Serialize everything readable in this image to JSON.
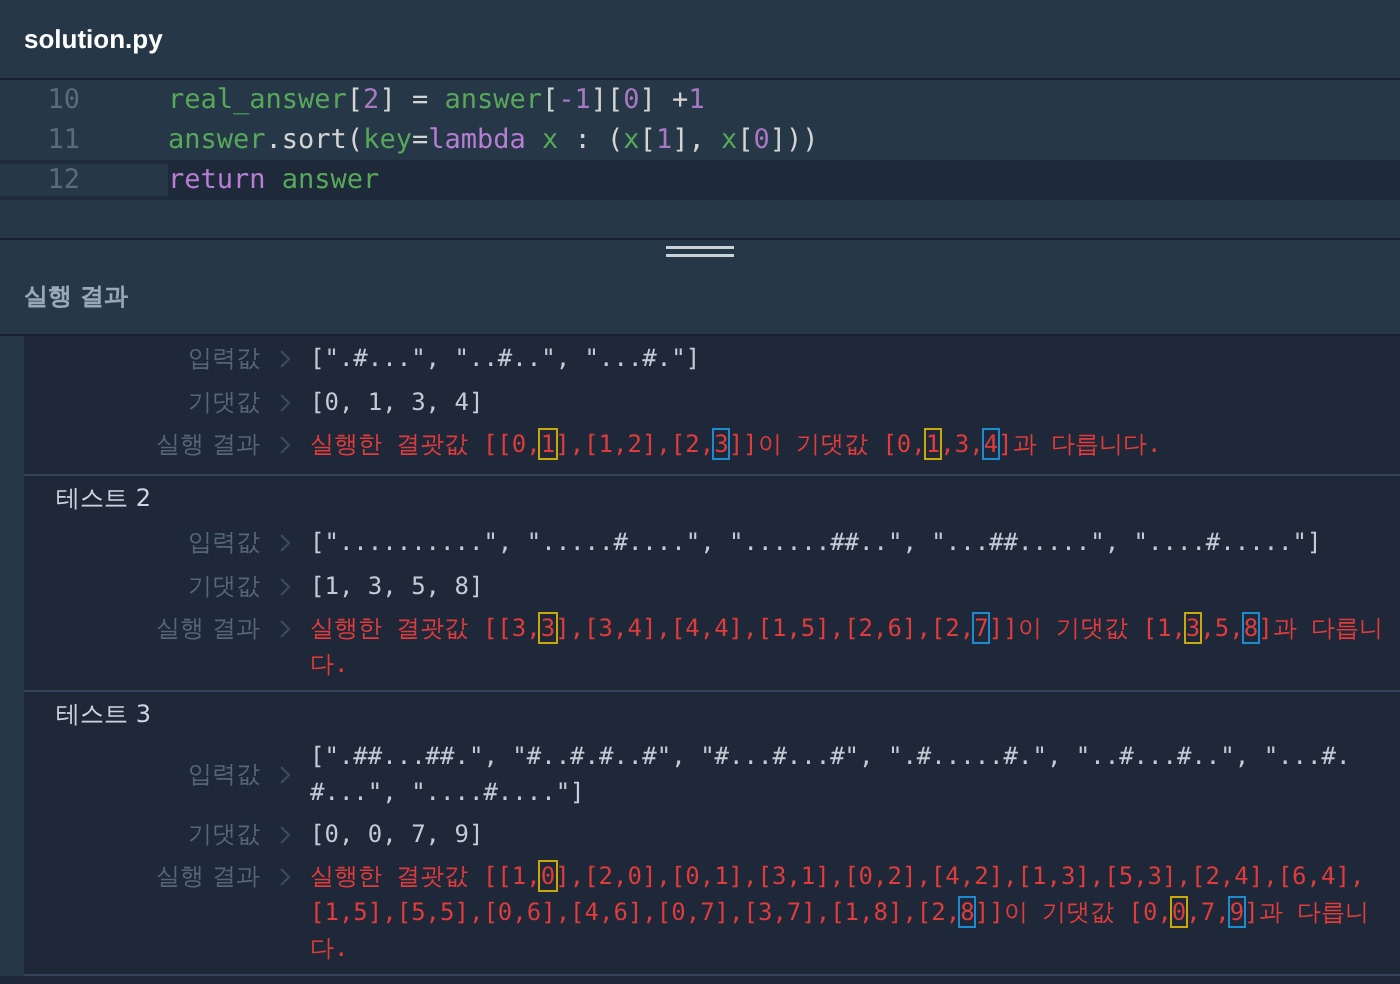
{
  "file": {
    "title": "solution.py"
  },
  "editor": {
    "lines": [
      {
        "number": "10",
        "selected": false,
        "tokens": [
          {
            "text": "real_answer",
            "kind": "name"
          },
          {
            "text": "[",
            "kind": "plain"
          },
          {
            "text": "2",
            "kind": "number"
          },
          {
            "text": "] = ",
            "kind": "plain"
          },
          {
            "text": "answer",
            "kind": "name"
          },
          {
            "text": "[",
            "kind": "plain"
          },
          {
            "text": "-1",
            "kind": "number"
          },
          {
            "text": "][",
            "kind": "plain"
          },
          {
            "text": "0",
            "kind": "number"
          },
          {
            "text": "] +",
            "kind": "plain"
          },
          {
            "text": "1",
            "kind": "number"
          }
        ]
      },
      {
        "number": "11",
        "selected": false,
        "tokens": [
          {
            "text": "answer",
            "kind": "name"
          },
          {
            "text": ".sort(",
            "kind": "plain"
          },
          {
            "text": "key",
            "kind": "name"
          },
          {
            "text": "=",
            "kind": "plain"
          },
          {
            "text": "lambda",
            "kind": "keyword"
          },
          {
            "text": " x",
            "kind": "name"
          },
          {
            "text": " : (",
            "kind": "plain"
          },
          {
            "text": "x",
            "kind": "name"
          },
          {
            "text": "[",
            "kind": "plain"
          },
          {
            "text": "1",
            "kind": "number"
          },
          {
            "text": "], ",
            "kind": "plain"
          },
          {
            "text": "x",
            "kind": "name"
          },
          {
            "text": "[",
            "kind": "plain"
          },
          {
            "text": "0",
            "kind": "number"
          },
          {
            "text": "]))",
            "kind": "plain"
          }
        ]
      },
      {
        "number": "12",
        "selected": true,
        "tokens": [
          {
            "text": "return",
            "kind": "keyword"
          },
          {
            "text": " answer",
            "kind": "name"
          }
        ]
      }
    ]
  },
  "results_panel": {
    "title": "실행 결과"
  },
  "tests": [
    {
      "rows": [
        {
          "label": "입력값",
          "kind": "value",
          "segments": [
            {
              "text": "[\".#...\", \"..#..\", \"...#.\"]"
            }
          ]
        },
        {
          "label": "기댓값",
          "kind": "value",
          "segments": [
            {
              "text": "[0, 1, 3, 4]"
            }
          ]
        },
        {
          "label": "실행 결과",
          "kind": "error",
          "segments": [
            {
              "text": "실행한 결괏값 [[0,"
            },
            {
              "text": "1",
              "color": "#c9a80a"
            },
            {
              "text": "],[1,2],[2,"
            },
            {
              "text": "3",
              "color": "#1e8ad0"
            },
            {
              "text": "]]이 기댓값 [0,"
            },
            {
              "text": "1",
              "color": "#c9a80a"
            },
            {
              "text": ",3,"
            },
            {
              "text": "4",
              "color": "#1e8ad0"
            },
            {
              "text": "]과 다릅니다."
            }
          ]
        }
      ]
    },
    {
      "title": "테스트 2",
      "rows": [
        {
          "label": "입력값",
          "kind": "value",
          "segments": [
            {
              "text": "[\"..........\", \".....#....\", \"......##..\", \"...##.....\", \"....#.....\"]"
            }
          ]
        },
        {
          "label": "기댓값",
          "kind": "value",
          "segments": [
            {
              "text": "[1, 3, 5, 8]"
            }
          ]
        },
        {
          "label": "실행 결과",
          "kind": "error",
          "segments": [
            {
              "text": "실행한 결괏값 [[3,"
            },
            {
              "text": "3",
              "color": "#c9a80a"
            },
            {
              "text": "],[3,4],[4,4],[1,5],[2,6],[2,"
            },
            {
              "text": "7",
              "color": "#1e8ad0"
            },
            {
              "text": "]]이 기댓값 [1,"
            },
            {
              "text": "3",
              "color": "#c9a80a"
            },
            {
              "text": ",5,"
            },
            {
              "text": "8",
              "color": "#1e8ad0"
            },
            {
              "text": "]과 다릅니다."
            }
          ]
        }
      ]
    },
    {
      "title": "테스트 3",
      "rows": [
        {
          "label": "입력값",
          "kind": "value",
          "segments": [
            {
              "text": "[\".##...##.\", \"#..#.#..#\", \"#...#...#\", \".#.....#.\", \"..#...#..\", \"...#.#...\", \"....#....\"]"
            }
          ]
        },
        {
          "label": "기댓값",
          "kind": "value",
          "segments": [
            {
              "text": "[0, 0, 7, 9]"
            }
          ]
        },
        {
          "label": "실행 결과",
          "kind": "error",
          "segments": [
            {
              "text": "실행한 결괏값 [[1,"
            },
            {
              "text": "0",
              "color": "#c9a80a"
            },
            {
              "text": "],[2,0],[0,1],[3,1],[0,2],[4,2],[1,3],[5,3],[2,4],[6,4],[1,5],[5,5],[0,6],[4,6],[0,7],[3,7],[1,8],[2,"
            },
            {
              "text": "8",
              "color": "#1e8ad0"
            },
            {
              "text": "]]이 기댓값 [0,"
            },
            {
              "text": "0",
              "color": "#c9a80a"
            },
            {
              "text": ",7,"
            },
            {
              "text": "9",
              "color": "#1e8ad0"
            },
            {
              "text": "]과 다릅니다."
            }
          ]
        }
      ]
    }
  ]
}
